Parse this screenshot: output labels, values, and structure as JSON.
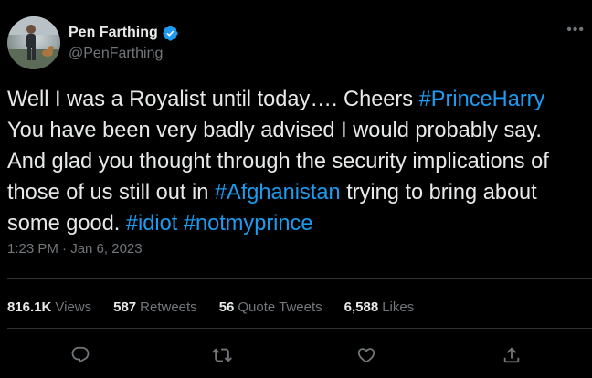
{
  "tweet": {
    "author": {
      "display_name": "Pen Farthing",
      "handle": "@PenFarthing",
      "verified": true
    },
    "more_icon": "•••",
    "text_parts": [
      {
        "text": "Well I was a Royalist until today…. Cheers ",
        "type": "text"
      },
      {
        "text": "#PrinceHarry",
        "type": "hashtag"
      },
      {
        "text": " You have been very badly advised I would probably say. And glad you thought through the security implications of those of us still out in ",
        "type": "text"
      },
      {
        "text": "#Afghanistan",
        "type": "hashtag"
      },
      {
        "text": " trying to bring about some good. ",
        "type": "text"
      },
      {
        "text": "#idiot",
        "type": "hashtag"
      },
      {
        "text": " ",
        "type": "text"
      },
      {
        "text": "#notmyprince",
        "type": "hashtag"
      }
    ],
    "timestamp": "1:23 PM · Jan 6, 2023",
    "stats": {
      "views": {
        "num": "816.1K",
        "label": "Views"
      },
      "retweets": {
        "num": "587",
        "label": "Retweets"
      },
      "quotes": {
        "num": "56",
        "label": "Quote Tweets"
      },
      "likes": {
        "num": "6,588",
        "label": "Likes"
      }
    },
    "actions": [
      "reply-icon",
      "retweet-icon",
      "like-icon",
      "share-icon"
    ],
    "colors": {
      "background": "#000000",
      "text": "#e7e9ea",
      "muted": "#71767b",
      "accent": "#1d9bf0",
      "divider": "#2f3336"
    }
  }
}
